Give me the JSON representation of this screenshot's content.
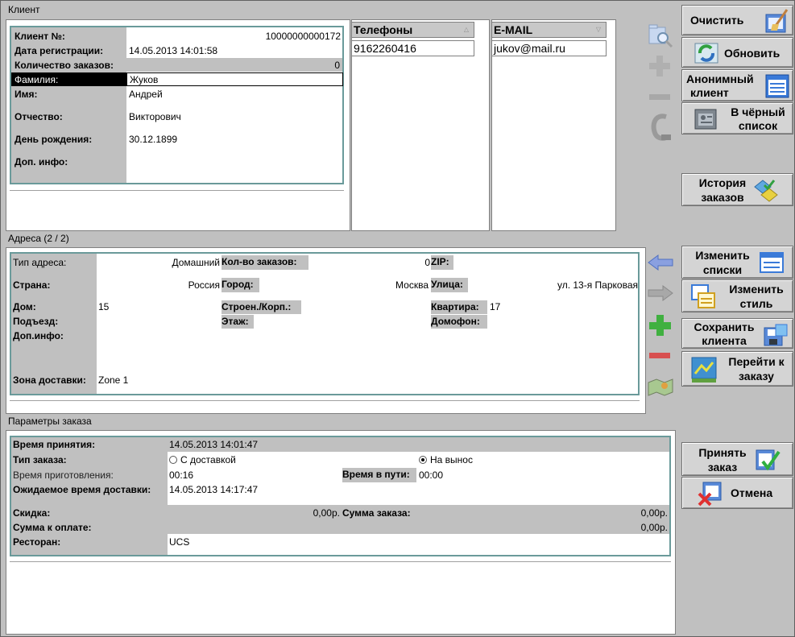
{
  "client": {
    "section_title": "Клиент",
    "fields": {
      "client_no_label": "Клиент №:",
      "client_no": "10000000000172",
      "reg_date_label": "Дата регистрации:",
      "reg_date": "14.05.2013 14:01:58",
      "orders_count_label": "Количество заказов:",
      "orders_count": "0",
      "surname_label": "Фамилия:",
      "surname": "Жуков",
      "name_label": "Имя:",
      "name": "Андрей",
      "patronymic_label": "Отчество:",
      "patronymic": "Викторович",
      "birthday_label": "День рождения:",
      "birthday": "30.12.1899",
      "extra_label": "Доп. инфо:",
      "extra": ""
    },
    "phones_header": "Телефоны",
    "phones": [
      "9162260416"
    ],
    "email_header": "E-MAIL",
    "emails": [
      "jukov@mail.ru"
    ]
  },
  "address": {
    "section_title": "Адреса  (2 / 2)",
    "type_label": "Тип адреса:",
    "type": "Домашний",
    "orders_label": "Кол-во заказов:",
    "orders": "0",
    "zip_label": "ZIP:",
    "zip": "",
    "country_label": "Страна:",
    "country": "Россия",
    "city_label": "Город:",
    "city": "Москва",
    "street_label": "Улица:",
    "street": "ул. 13-я Парковая",
    "house_label": "Дом:",
    "house": "15",
    "building_label": "Строен./Корп.:",
    "building": "",
    "flat_label": "Квартира:",
    "flat": "17",
    "entrance_label": "Подъезд:",
    "entrance": "",
    "floor_label": "Этаж:",
    "floor": "",
    "intercom_label": "Домофон:",
    "intercom": "",
    "extra_label": "Доп.инфо:",
    "extra": "",
    "zone_label": "Зона доставки:",
    "zone": "Zone 1"
  },
  "order": {
    "section_title": "Параметры заказа",
    "accept_time_label": "Время принятия:",
    "accept_time": "14.05.2013 14:01:47",
    "order_type_label": "Тип заказа:",
    "delivery_option": "С доставкой",
    "takeaway_option": "На вынос",
    "prep_time_label": "Время приготовления:",
    "prep_time": "00:16",
    "travel_time_label": "Время в пути:",
    "travel_time": "00:00",
    "expected_label": "Ожидаемое время доставки:",
    "expected": "14.05.2013 14:17:47",
    "discount_label": "Скидка:",
    "discount": "0,00р.",
    "sum_label": "Сумма заказа:",
    "sum": "0,00р.",
    "to_pay_label": "Сумма к оплате:",
    "to_pay": "0,00р.",
    "restaurant_label": "Ресторан:",
    "restaurant": "UCS"
  },
  "buttons": {
    "clear": "Очистить",
    "refresh": "Обновить",
    "anon_1": "Анонимный",
    "anon_2": "клиент",
    "black_1": "В чёрный",
    "black_2": "список",
    "history_1": "История",
    "history_2": "заказов",
    "edit_lists_1": "Изменить",
    "edit_lists_2": "списки",
    "edit_style_1": "Изменить",
    "edit_style_2": "стиль",
    "save_1": "Сохранить",
    "save_2": "клиента",
    "goto_1": "Перейти к",
    "goto_2": "заказу",
    "accept_1": "Принять",
    "accept_2": "заказ",
    "cancel": "Отмена"
  }
}
